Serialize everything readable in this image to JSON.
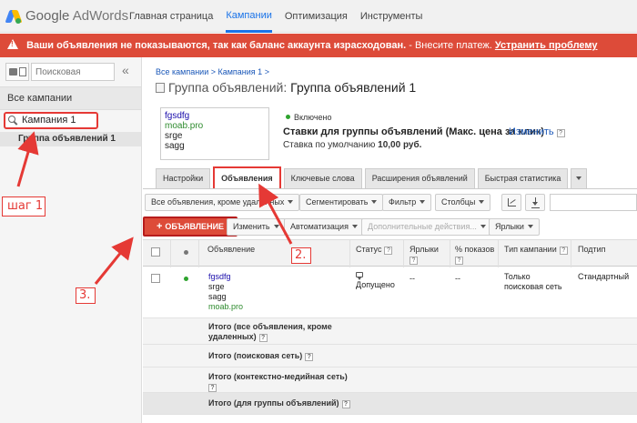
{
  "header": {
    "logo_google": "Google",
    "logo_product": "AdWords",
    "nav": [
      "Главная страница",
      "Кампании",
      "Оптимизация",
      "Инструменты"
    ],
    "active_nav": "Кампании"
  },
  "alert": {
    "message": "Ваши объявления не показываются, так как баланс аккаунта израсходован.",
    "hint": " - Внесите платеж.",
    "link": "Устранить проблему"
  },
  "sidebar": {
    "search_placeholder": "Поисковая",
    "collapse": "«",
    "all_campaigns": "Все кампании",
    "campaign": "Кампания 1",
    "ad_group": "Группа объявлений 1"
  },
  "main": {
    "breadcrumb": "Все кампании > Кампания 1 >",
    "title_prefix": "Группа объявлений:",
    "title_name": "Группа объявлений 1",
    "ad_preview": [
      "fgsdfg",
      "moab.pro",
      "srge",
      "sagg"
    ],
    "status": "Включено",
    "bid_title": "Ставки для группы объявлений (Макс. цена за клик)",
    "bid_change": "Изменить",
    "bid_default_label": "Ставка по умолчанию",
    "bid_default_value": "10,00 руб."
  },
  "tabs": [
    "Настройки",
    "Объявления",
    "Ключевые слова",
    "Расширения объявлений",
    "Быстрая статистика"
  ],
  "toolbar": {
    "filter_all": "Все объявления, кроме удаленных",
    "segment": "Сегментировать",
    "filter": "Фильтр",
    "columns": "Столбцы",
    "add_ad": "ОБЪЯВЛЕНИЕ",
    "edit": "Изменить",
    "automate": "Автоматизация",
    "more_actions": "Дополнительные действия...",
    "labels": "Ярлыки"
  },
  "table": {
    "headers": {
      "ad": "Объявление",
      "status": "Статус",
      "labels": "Ярлыки",
      "impr_share_1": "% показов",
      "impr_share_2": "",
      "campaign_type": "Тип кампании",
      "subtype": "Подтип"
    },
    "row": {
      "ad_lines": [
        "fgsdfg",
        "srge",
        "sagg",
        "moab.pro"
      ],
      "status": "Допущено",
      "labels": "--",
      "impr_share": "--",
      "campaign_type_1": "Только",
      "campaign_type_2": "поисковая сеть",
      "subtype": "Стандартный"
    },
    "totals": [
      "Итого (все объявления, кроме удаленных)",
      "Итого (поисковая сеть)",
      "Итого (контекстно-медийная сеть)",
      "Итого (для группы объявлений)"
    ]
  },
  "annotations": {
    "step1": "шаг 1",
    "step2": "2.",
    "step3": "3."
  },
  "colors": {
    "accent_blue": "#1a73e8",
    "alert_red": "#dd4b39",
    "annotation_red": "#e53935",
    "link_blue": "#1a0dab",
    "url_green": "#2e8b2e"
  }
}
